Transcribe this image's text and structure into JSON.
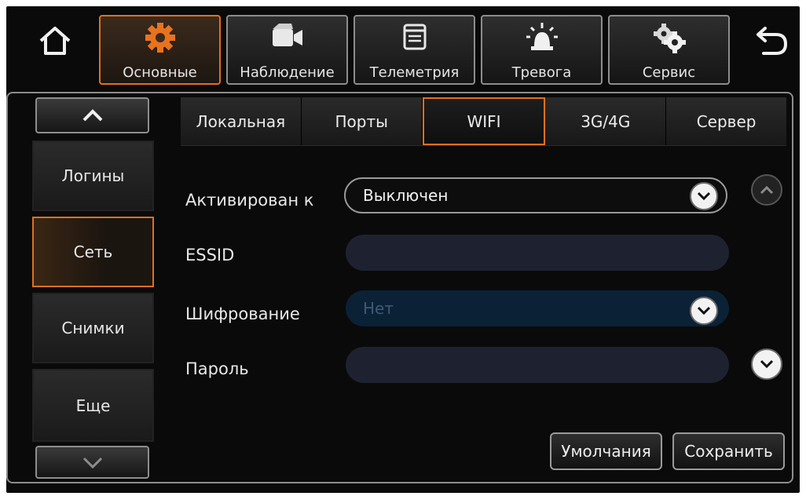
{
  "nav": {
    "tabs": [
      {
        "label": "Основные",
        "icon": "gear-icon",
        "active": true
      },
      {
        "label": "Наблюдение",
        "icon": "camera-icon",
        "active": false
      },
      {
        "label": "Телеметрия",
        "icon": "window-icon",
        "active": false
      },
      {
        "label": "Тревога",
        "icon": "alarm-light-icon",
        "active": false
      },
      {
        "label": "Сервис",
        "icon": "gears-icon",
        "active": false
      }
    ],
    "home_icon": "home-icon",
    "back_icon": "back-arrow-icon"
  },
  "sidebar": {
    "items": [
      {
        "label": "Логины"
      },
      {
        "label": "Сеть",
        "active": true
      },
      {
        "label": "Снимки"
      },
      {
        "label": "Еще"
      }
    ]
  },
  "subtabs": [
    {
      "label": "Локальная"
    },
    {
      "label": "Порты"
    },
    {
      "label": "WIFI",
      "active": true
    },
    {
      "label": "3G/4G"
    },
    {
      "label": "Сервер"
    }
  ],
  "form": {
    "activated_label": "Активирован к",
    "activated_value": "Выключен",
    "essid_label": "ESSID",
    "essid_value": "",
    "encryption_label": "Шифрование",
    "encryption_value": "Нет",
    "password_label": "Пароль",
    "password_value": ""
  },
  "buttons": {
    "defaults": "Умолчания",
    "save": "Сохранить"
  },
  "colors": {
    "accent": "#e0701f",
    "field": "#1e2230",
    "field_disabled": "#0b2136"
  }
}
